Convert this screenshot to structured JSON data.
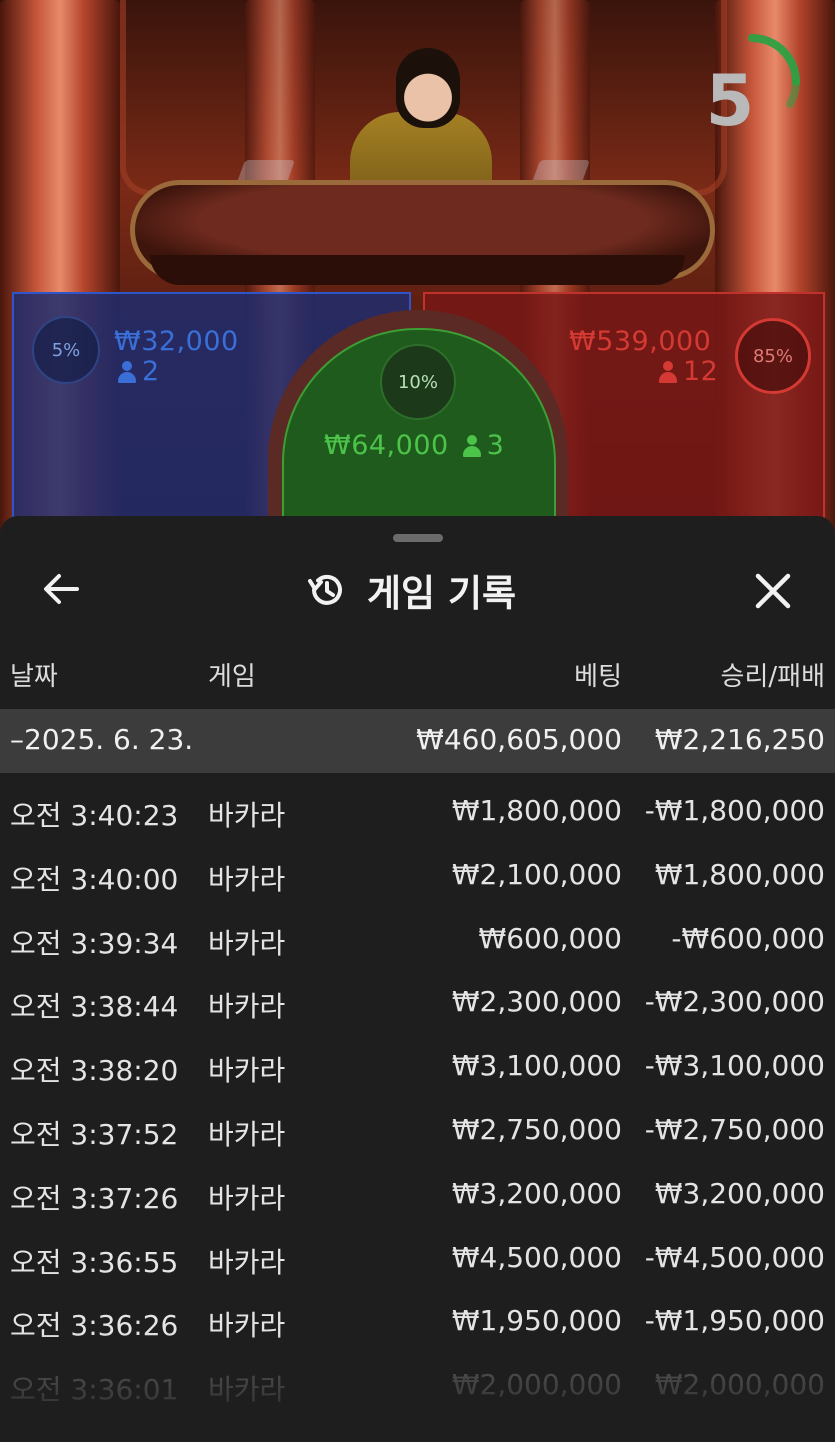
{
  "countdown": {
    "value": "5",
    "color": "#2ea043"
  },
  "zones": {
    "player": {
      "percent": "5%",
      "amount": "₩32,000",
      "players": "2",
      "color": "#3a6fd8"
    },
    "tie": {
      "percent": "10%",
      "amount": "₩64,000",
      "players": "3",
      "color": "#4cc44a"
    },
    "banker": {
      "percent": "85%",
      "amount": "₩539,000",
      "players": "12",
      "color": "#d43a33"
    }
  },
  "panel": {
    "title": "게임 기록",
    "title_icon": "history-icon",
    "back_icon": "arrow-left-icon",
    "close_icon": "close-icon",
    "columns": {
      "date": "날짜",
      "game": "게임",
      "bet": "베팅",
      "win_loss": "승리/패배"
    },
    "day": {
      "label": "–2025. 6. 23.",
      "bet": "₩460,605,000",
      "win_loss": "₩2,216,250"
    },
    "rows": [
      {
        "time": "오전 3:40:23",
        "game": "바카라",
        "bet": "₩1,800,000",
        "win_loss": "-₩1,800,000"
      },
      {
        "time": "오전 3:40:00",
        "game": "바카라",
        "bet": "₩2,100,000",
        "win_loss": "₩1,800,000"
      },
      {
        "time": "오전 3:39:34",
        "game": "바카라",
        "bet": "₩600,000",
        "win_loss": "-₩600,000"
      },
      {
        "time": "오전 3:38:44",
        "game": "바카라",
        "bet": "₩2,300,000",
        "win_loss": "-₩2,300,000"
      },
      {
        "time": "오전 3:38:20",
        "game": "바카라",
        "bet": "₩3,100,000",
        "win_loss": "-₩3,100,000"
      },
      {
        "time": "오전 3:37:52",
        "game": "바카라",
        "bet": "₩2,750,000",
        "win_loss": "-₩2,750,000"
      },
      {
        "time": "오전 3:37:26",
        "game": "바카라",
        "bet": "₩3,200,000",
        "win_loss": "₩3,200,000"
      },
      {
        "time": "오전 3:36:55",
        "game": "바카라",
        "bet": "₩4,500,000",
        "win_loss": "-₩4,500,000"
      },
      {
        "time": "오전 3:36:26",
        "game": "바카라",
        "bet": "₩1,950,000",
        "win_loss": "-₩1,950,000"
      },
      {
        "time": "오전 3:36:01",
        "game": "바카라",
        "bet": "₩2,000,000",
        "win_loss": "₩2,000,000"
      }
    ]
  }
}
